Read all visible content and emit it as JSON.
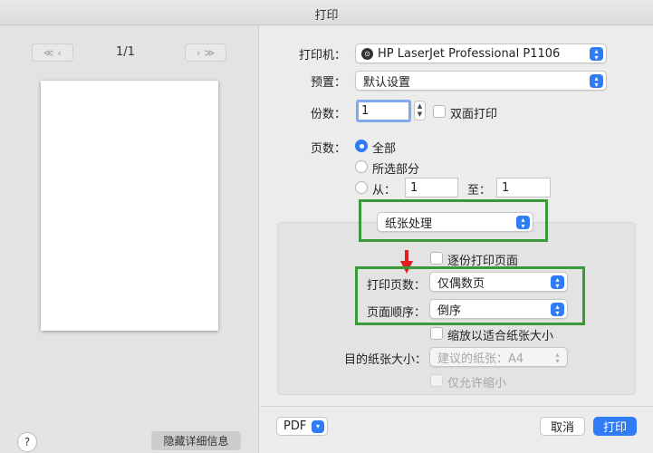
{
  "window": {
    "title": "打印"
  },
  "preview_nav": {
    "first_prev_icons": [
      "first-page-icon",
      "prev-page-icon"
    ],
    "next_last_icons": [
      "next-page-icon",
      "last-page-icon"
    ],
    "page_counter": "1/1"
  },
  "left_footer": {
    "help_label": "?",
    "hide_details_label": "隐藏详细信息"
  },
  "printer": {
    "label": "打印机：",
    "value": "HP LaserJet Professional P1106",
    "icon": "printer-icon"
  },
  "presets": {
    "label": "预置：",
    "value": "默认设置"
  },
  "copies": {
    "label": "份数：",
    "value": "1",
    "duplex_label": "双面打印"
  },
  "pages": {
    "label": "页数：",
    "all_label": "全部",
    "selection_label": "所选部分",
    "from_label": "从：",
    "from_value": "1",
    "to_label": "至：",
    "to_value": "1",
    "selected": "all"
  },
  "section_popup": {
    "value": "纸张处理"
  },
  "paper_handling": {
    "collate_label": "逐份打印页面",
    "pages_to_print_label": "打印页数：",
    "pages_to_print_value": "仅偶数页",
    "page_order_label": "页面顺序：",
    "page_order_value": "倒序",
    "scale_to_fit_label": "缩放以适合纸张大小",
    "dest_paper_label": "目的纸张大小：",
    "dest_paper_value": "建议的纸张：A4",
    "scale_down_only_label": "仅允许缩小"
  },
  "footer": {
    "pdf_label": "PDF",
    "cancel_label": "取消",
    "print_label": "打印"
  },
  "colors": {
    "accent": "#2f7cf6",
    "annotation_green": "#3a9a3a",
    "annotation_red": "#e02020"
  }
}
